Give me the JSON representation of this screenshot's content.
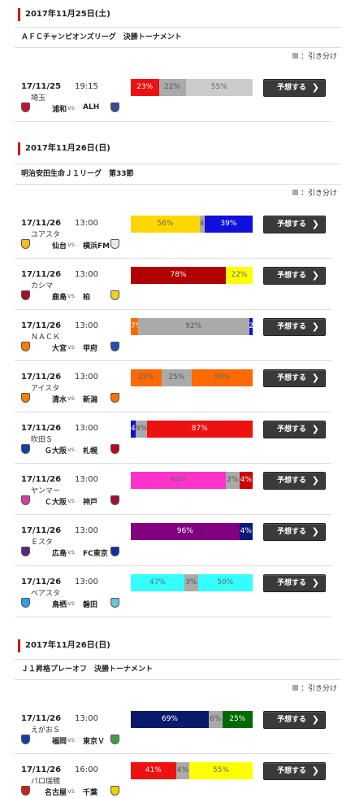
{
  "legend_label": "：引き分け",
  "predict_label": "予想する",
  "vs_label": "vs",
  "sections": [
    {
      "date": "2017年11月25日(土)",
      "competition": "ＡＦＣチャンピオンズリーグ　決勝トーナメント",
      "matches": [
        {
          "date": "17/11/25",
          "time": "19:15",
          "venue": "埼玉",
          "home": "浦和",
          "away": "ALH",
          "home_color": "#c8102e",
          "away_color": "#3a4a9a",
          "segments": [
            {
              "label": "23%",
              "value": 23,
              "color": "#ee1111",
              "text": "#ffffff"
            },
            {
              "label": "22%",
              "value": 22,
              "color": "#aaaaaa",
              "text": "#555555"
            },
            {
              "label": "55%",
              "value": 55,
              "color": "#cccccc",
              "text": "#666666"
            }
          ]
        }
      ]
    },
    {
      "date": "2017年11月26日(日)",
      "competition": "明治安田生命Ｊ１リーグ　第33節",
      "matches": [
        {
          "date": "17/11/26",
          "time": "13:00",
          "venue": "ユアスタ",
          "home": "仙台",
          "away": "横浜FM",
          "home_color": "#f0c020",
          "away_color": "#e8e8e8",
          "segments": [
            {
              "label": "56%",
              "value": 56,
              "color": "#ffd700",
              "text": "#666666"
            },
            {
              "label": "4%",
              "value": 4,
              "color": "#aaaaaa",
              "text": "#555555"
            },
            {
              "label": "39%",
              "value": 39,
              "color": "#1010dd",
              "text": "#ffffff"
            }
          ]
        },
        {
          "date": "17/11/26",
          "time": "13:00",
          "venue": "カシマ",
          "home": "鹿島",
          "away": "柏",
          "home_color": "#a0102a",
          "away_color": "#f0d020",
          "segments": [
            {
              "label": "78%",
              "value": 78,
              "color": "#b00000",
              "text": "#ffffff"
            },
            {
              "label": "22%",
              "value": 22,
              "color": "#ffff00",
              "text": "#666666"
            }
          ]
        },
        {
          "date": "17/11/26",
          "time": "13:00",
          "venue": "ＮＡＣＫ",
          "home": "大宮",
          "away": "甲府",
          "home_color": "#ff7a00",
          "away_color": "#2050b0",
          "segments": [
            {
              "label": "7%",
              "value": 6,
              "color": "#ff6a00",
              "text": "#ffffff"
            },
            {
              "label": "92%",
              "value": 91,
              "color": "#aaaaaa",
              "text": "#555555"
            },
            {
              "label": "2%",
              "value": 3,
              "color": "#1010dd",
              "text": "#ffffff"
            }
          ]
        },
        {
          "date": "17/11/26",
          "time": "13:00",
          "venue": "アイスタ",
          "home": "清水",
          "away": "新潟",
          "home_color": "#f08000",
          "away_color": "#ff7000",
          "segments": [
            {
              "label": "25%",
              "value": 25,
              "color": "#ff6a00",
              "text": "#666666"
            },
            {
              "label": "25%",
              "value": 25,
              "color": "#aaaaaa",
              "text": "#555555"
            },
            {
              "label": "50%",
              "value": 50,
              "color": "#ff6a00",
              "text": "#666666"
            }
          ]
        },
        {
          "date": "17/11/26",
          "time": "13:00",
          "venue": "吹田Ｓ",
          "home": "Ｇ大阪",
          "away": "札幌",
          "home_color": "#1040a0",
          "away_color": "#c00020",
          "segments": [
            {
              "label": "4%",
              "value": 4,
              "color": "#1010dd",
              "text": "#ffffff"
            },
            {
              "label": "9%",
              "value": 9,
              "color": "#aaaaaa",
              "text": "#555555"
            },
            {
              "label": "87%",
              "value": 87,
              "color": "#ee1111",
              "text": "#ffffff"
            }
          ]
        },
        {
          "date": "17/11/26",
          "time": "13:00",
          "venue": "ヤンマー",
          "home": "Ｃ大阪",
          "away": "神戸",
          "home_color": "#d040a0",
          "away_color": "#a01030",
          "segments": [
            {
              "label": "94%",
              "value": 78,
              "color": "#ff33cc",
              "text": "#666666"
            },
            {
              "label": "2%",
              "value": 11,
              "color": "#aaaaaa",
              "text": "#555555"
            },
            {
              "label": "4%",
              "value": 11,
              "color": "#cc0000",
              "text": "#ffffff"
            }
          ]
        },
        {
          "date": "17/11/26",
          "time": "13:00",
          "venue": "Ｅスタ",
          "home": "広島",
          "away": "FC東京",
          "home_color": "#602080",
          "away_color": "#1030a0",
          "segments": [
            {
              "label": "96%",
              "value": 89,
              "color": "#800080",
              "text": "#ffffff"
            },
            {
              "label": "4%",
              "value": 11,
              "color": "#0a1a7a",
              "text": "#ffffff"
            }
          ]
        },
        {
          "date": "17/11/26",
          "time": "13:00",
          "venue": "ベアスタ",
          "home": "鳥栖",
          "away": "磐田",
          "home_color": "#30a0e0",
          "away_color": "#70c0e0",
          "segments": [
            {
              "label": "47%",
              "value": 44,
              "color": "#33ffff",
              "text": "#666666"
            },
            {
              "label": "3%",
              "value": 11,
              "color": "#aaaaaa",
              "text": "#555555"
            },
            {
              "label": "50%",
              "value": 45,
              "color": "#33ffff",
              "text": "#666666"
            }
          ]
        }
      ]
    },
    {
      "date": "2017年11月26日(日)",
      "competition": "Ｊ１昇格プレーオフ　決勝トーナメント",
      "matches": [
        {
          "date": "17/11/26",
          "time": "13:00",
          "venue": "えがおＳ",
          "home": "福岡",
          "away": "東京Ｖ",
          "home_color": "#1040a0",
          "away_color": "#40a040",
          "segments": [
            {
              "label": "69%",
              "value": 64,
              "color": "#0a1a6a",
              "text": "#ffffff"
            },
            {
              "label": "6%",
              "value": 11,
              "color": "#aaaaaa",
              "text": "#555555"
            },
            {
              "label": "25%",
              "value": 25,
              "color": "#006a00",
              "text": "#ffffff"
            }
          ]
        },
        {
          "date": "17/11/26",
          "time": "16:00",
          "venue": "パロ瑞穂",
          "home": "名古屋",
          "away": "千葉",
          "home_color": "#d02020",
          "away_color": "#f0d000",
          "segments": [
            {
              "label": "41%",
              "value": 37,
              "color": "#ee1111",
              "text": "#ffffff"
            },
            {
              "label": "4%",
              "value": 11,
              "color": "#aaaaaa",
              "text": "#555555"
            },
            {
              "label": "55%",
              "value": 52,
              "color": "#ffff00",
              "text": "#666666"
            }
          ]
        }
      ]
    }
  ]
}
